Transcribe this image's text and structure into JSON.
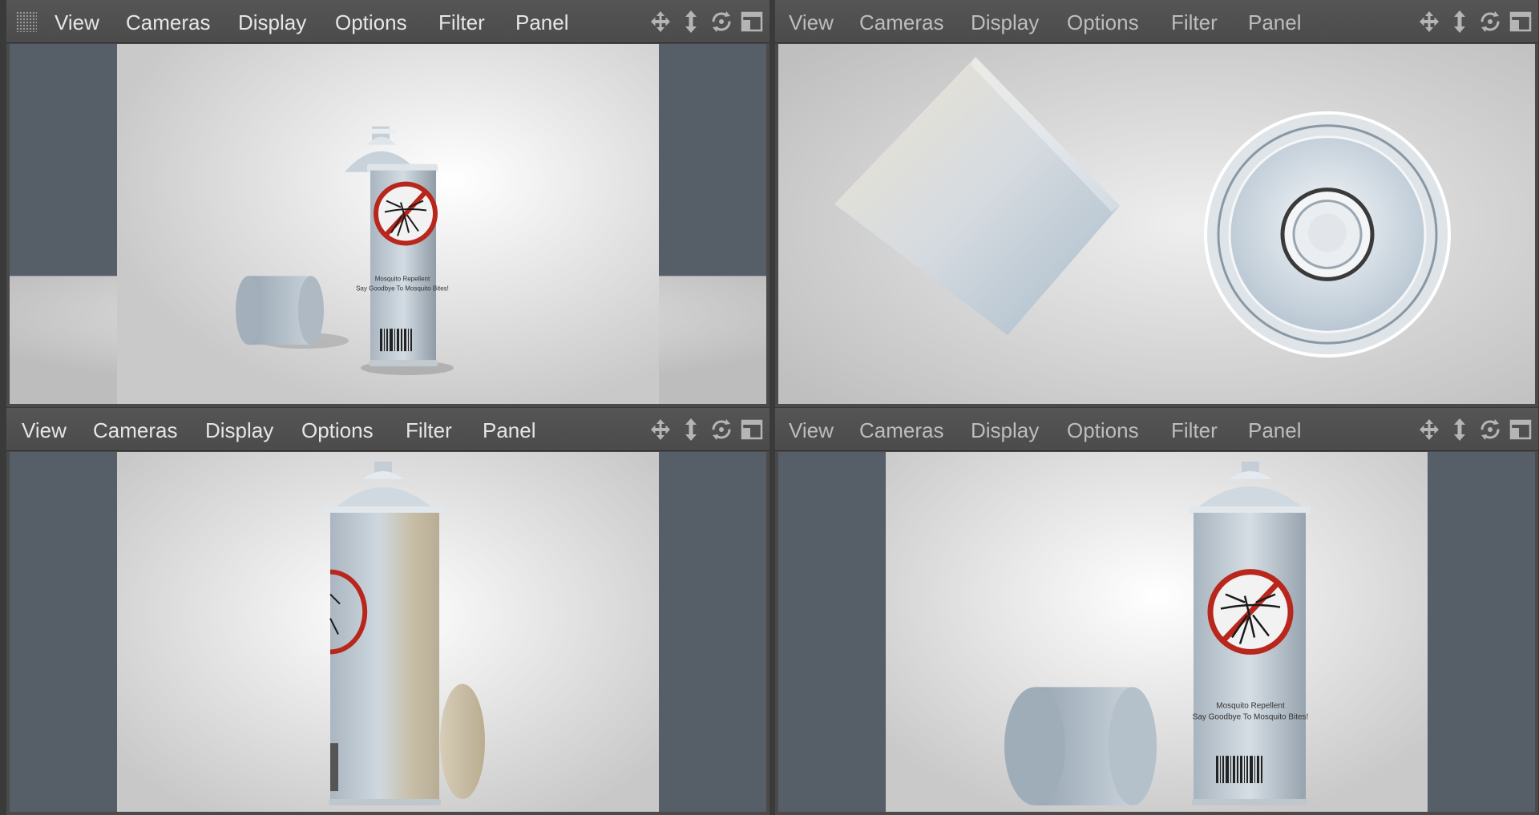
{
  "menu_labels": {
    "view": "View",
    "cameras": "Cameras",
    "display": "Display",
    "options": "Options",
    "filter": "Filter",
    "panel": "Panel"
  },
  "viewports": [
    {
      "id": "perspective",
      "active": true,
      "has_grip": true
    },
    {
      "id": "top",
      "active": false,
      "has_grip": false
    },
    {
      "id": "right",
      "active": true,
      "has_grip": false
    },
    {
      "id": "front",
      "active": false,
      "has_grip": false
    }
  ],
  "toolbar_icons": [
    "move-view-icon",
    "dolly-view-icon",
    "rotate-view-icon",
    "maximize-view-icon"
  ],
  "scene": {
    "label_line1": "Mosquito Repellent",
    "label_line2": "Say Goodbye To Mosquito Bites!"
  },
  "colors": {
    "menubar": "#4d4d4d",
    "menu_text": "#e6e6e6",
    "safe_frame": "#565e68",
    "no_sign_red": "#b8261c"
  }
}
